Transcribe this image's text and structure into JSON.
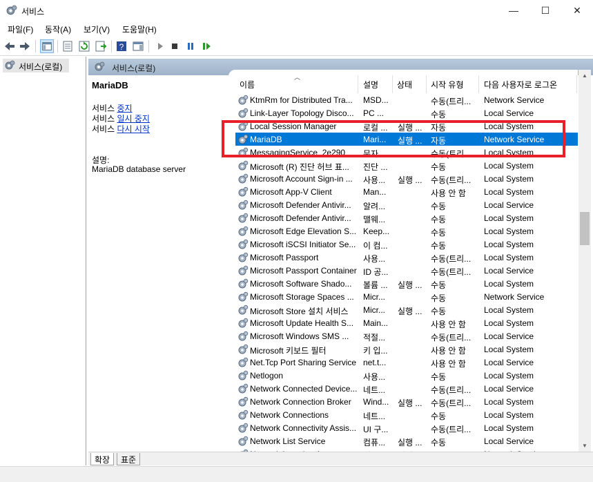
{
  "window": {
    "title": "서비스",
    "min_glyph": "—",
    "max_glyph": "☐",
    "close_glyph": "✕"
  },
  "menu": [
    "파일(F)",
    "동작(A)",
    "보기(V)",
    "도움말(H)"
  ],
  "tree": {
    "root_label": "서비스(로컬)"
  },
  "content_header": {
    "label": "서비스(로컬)"
  },
  "description": {
    "service_name": "MariaDB",
    "actions": [
      {
        "prefix": "서비스 ",
        "link": "중지"
      },
      {
        "prefix": "서비스 ",
        "link": "일시 중지"
      },
      {
        "prefix": "서비스 ",
        "link": "다시 시작"
      }
    ],
    "desc_label": "설명:",
    "desc_text": "MariaDB database server"
  },
  "columns": {
    "name": "이름",
    "desc": "설명",
    "status": "상태",
    "start": "시작 유형",
    "logon": "다음 사용자로 로그온"
  },
  "rows": [
    {
      "name": "KtmRm for Distributed Tra...",
      "desc": "MSD...",
      "status": "",
      "start": "수동(트리...",
      "logon": "Network Service"
    },
    {
      "name": "Link-Layer Topology Disco...",
      "desc": "PC ...",
      "status": "",
      "start": "수동",
      "logon": "Local Service"
    },
    {
      "name": "Local Session Manager",
      "desc": "로컬 ...",
      "status": "실행 ...",
      "start": "자동",
      "logon": "Local System"
    },
    {
      "name": "MariaDB",
      "desc": "Mari...",
      "status": "실행 ...",
      "start": "자동",
      "logon": "Network Service",
      "selected": true
    },
    {
      "name": "MessagingService_2e290",
      "desc": "문자 ...",
      "status": "",
      "start": "수동(트리...",
      "logon": "Local System"
    },
    {
      "name": "Microsoft (R) 진단 허브 표...",
      "desc": "진단 ...",
      "status": "",
      "start": "수동",
      "logon": "Local System"
    },
    {
      "name": "Microsoft Account Sign-in ...",
      "desc": "사용...",
      "status": "실행 ...",
      "start": "수동(트리...",
      "logon": "Local System"
    },
    {
      "name": "Microsoft App-V Client",
      "desc": "Man...",
      "status": "",
      "start": "사용 안 함",
      "logon": "Local System"
    },
    {
      "name": "Microsoft Defender Antivir...",
      "desc": "알려...",
      "status": "",
      "start": "수동",
      "logon": "Local Service"
    },
    {
      "name": "Microsoft Defender Antivir...",
      "desc": "맬웨...",
      "status": "",
      "start": "수동",
      "logon": "Local System"
    },
    {
      "name": "Microsoft Edge Elevation S...",
      "desc": "Keep...",
      "status": "",
      "start": "수동",
      "logon": "Local System"
    },
    {
      "name": "Microsoft iSCSI Initiator Se...",
      "desc": "이 컴...",
      "status": "",
      "start": "수동",
      "logon": "Local System"
    },
    {
      "name": "Microsoft Passport",
      "desc": "사용...",
      "status": "",
      "start": "수동(트리...",
      "logon": "Local System"
    },
    {
      "name": "Microsoft Passport Container",
      "desc": "ID 공...",
      "status": "",
      "start": "수동(트리...",
      "logon": "Local Service"
    },
    {
      "name": "Microsoft Software Shado...",
      "desc": "볼륨 ...",
      "status": "실행 ...",
      "start": "수동",
      "logon": "Local System"
    },
    {
      "name": "Microsoft Storage Spaces ...",
      "desc": "Micr...",
      "status": "",
      "start": "수동",
      "logon": "Network Service"
    },
    {
      "name": "Microsoft Store 설치 서비스",
      "desc": "Micr...",
      "status": "실행 ...",
      "start": "수동",
      "logon": "Local System"
    },
    {
      "name": "Microsoft Update Health S...",
      "desc": "Main...",
      "status": "",
      "start": "사용 안 함",
      "logon": "Local System"
    },
    {
      "name": "Microsoft Windows SMS ...",
      "desc": "적절...",
      "status": "",
      "start": "수동(트리...",
      "logon": "Local Service"
    },
    {
      "name": "Microsoft 키보드 필터",
      "desc": "키 입...",
      "status": "",
      "start": "사용 안 함",
      "logon": "Local System"
    },
    {
      "name": "Net.Tcp Port Sharing Service",
      "desc": "net.t...",
      "status": "",
      "start": "사용 안 함",
      "logon": "Local Service"
    },
    {
      "name": "Netlogon",
      "desc": "사용...",
      "status": "",
      "start": "수동",
      "logon": "Local System"
    },
    {
      "name": "Network Connected Device...",
      "desc": "네트...",
      "status": "",
      "start": "수동(트리...",
      "logon": "Local Service"
    },
    {
      "name": "Network Connection Broker",
      "desc": "Wind...",
      "status": "실행 ...",
      "start": "수동(트리...",
      "logon": "Local System"
    },
    {
      "name": "Network Connections",
      "desc": "네트...",
      "status": "",
      "start": "수동",
      "logon": "Local System"
    },
    {
      "name": "Network Connectivity Assis...",
      "desc": "UI 구...",
      "status": "",
      "start": "수동(트리...",
      "logon": "Local System"
    },
    {
      "name": "Network List Service",
      "desc": "컴퓨...",
      "status": "실행 ...",
      "start": "수동",
      "logon": "Local Service"
    },
    {
      "name": "Network Location Awareness",
      "desc": "네트...",
      "status": "실행 ...",
      "start": "자동",
      "logon": "Network Service"
    }
  ],
  "tabs": [
    "확장",
    "표준"
  ],
  "colors": {
    "selection": "#0078d7",
    "highlight_box": "#e8202a",
    "link": "#0033cc"
  }
}
